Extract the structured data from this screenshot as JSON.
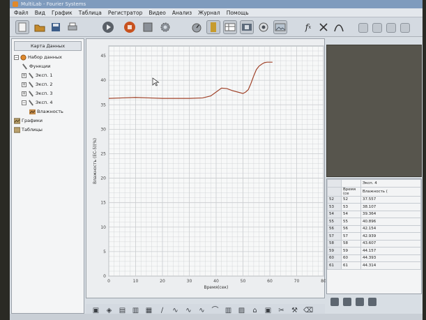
{
  "window": {
    "title": "MultiLab - Fourier Systems"
  },
  "menu": [
    "Файл",
    "Вид",
    "График",
    "Таблица",
    "Регистратор",
    "Видео",
    "Анализ",
    "Журнал",
    "Помощь"
  ],
  "toolbar": {
    "icons": [
      "new-file-icon",
      "open-folder-icon",
      "save-icon",
      "print-icon",
      "play-icon",
      "stop-icon",
      "logger-setup-icon",
      "settings-gear-icon",
      "meter-icon",
      "graph-view-icon",
      "table-view-icon",
      "video-icon",
      "camera-icon",
      "image-icon",
      "function-icon",
      "remove-function-icon",
      "smooth-icon"
    ]
  },
  "left_panel": {
    "header": "Карта Данных",
    "tree": [
      {
        "label": "Набор данных",
        "level": 0,
        "expand": "−",
        "icon": "dataset-icon"
      },
      {
        "label": "Функции",
        "level": 1,
        "expand": "",
        "icon": "probe-icon"
      },
      {
        "label": "Эксп. 1",
        "level": 1,
        "expand": "+",
        "icon": "probe-icon"
      },
      {
        "label": "Эксп. 2",
        "level": 1,
        "expand": "+",
        "icon": "probe-icon"
      },
      {
        "label": "Эксп. 3",
        "level": 1,
        "expand": "+",
        "icon": "probe-icon"
      },
      {
        "label": "Эксп. 4",
        "level": 1,
        "expand": "−",
        "icon": "probe-icon"
      },
      {
        "label": "Влажность",
        "level": 2,
        "expand": "",
        "icon": "series-icon"
      },
      {
        "label": "Графики",
        "level": 0,
        "expand": "",
        "icon": "graph-folder-icon"
      },
      {
        "label": "Таблицы",
        "level": 0,
        "expand": "",
        "icon": "table-folder-icon"
      }
    ]
  },
  "chart_data": {
    "type": "line",
    "xlabel": "Время(сек)",
    "ylabel": "Влажность (ЕС-5)(%)",
    "xlim": [
      0,
      80
    ],
    "ylim": [
      0,
      47
    ],
    "xticks": [
      0,
      10,
      20,
      30,
      40,
      50,
      60,
      70,
      80
    ],
    "yticks": [
      0,
      5,
      10,
      15,
      20,
      25,
      30,
      35,
      40,
      45
    ],
    "grid": true,
    "series": [
      {
        "color": "#a0432a",
        "x": [
          0,
          5,
          10,
          15,
          20,
          25,
          30,
          35,
          38,
          40,
          42,
          44,
          46,
          48,
          50,
          51,
          52,
          53,
          54,
          55,
          56,
          57,
          58,
          59,
          60,
          61
        ],
        "y": [
          36.3,
          36.4,
          36.5,
          36.4,
          36.3,
          36.3,
          36.3,
          36.4,
          36.8,
          37.6,
          38.4,
          38.3,
          37.9,
          37.6,
          37.3,
          37.6,
          38.1,
          39.4,
          40.9,
          42.2,
          42.9,
          43.3,
          43.6,
          43.7,
          43.7,
          43.7
        ]
      }
    ]
  },
  "table": {
    "series_header": "Эксп. 4",
    "columns": [
      "Время (се",
      "Влажность ("
    ],
    "rows": [
      [
        "52",
        "52",
        "37.557"
      ],
      [
        "53",
        "53",
        "38.107"
      ],
      [
        "54",
        "54",
        "39.364"
      ],
      [
        "55",
        "55",
        "40.896"
      ],
      [
        "56",
        "56",
        "42.154"
      ],
      [
        "57",
        "57",
        "42.939"
      ],
      [
        "58",
        "58",
        "43.607"
      ],
      [
        "59",
        "59",
        "44.157"
      ],
      [
        "60",
        "60",
        "44.393"
      ],
      [
        "61",
        "61",
        "44.314"
      ]
    ]
  },
  "colors": {
    "series": "#a0432a",
    "grid": "#c8cbce"
  }
}
